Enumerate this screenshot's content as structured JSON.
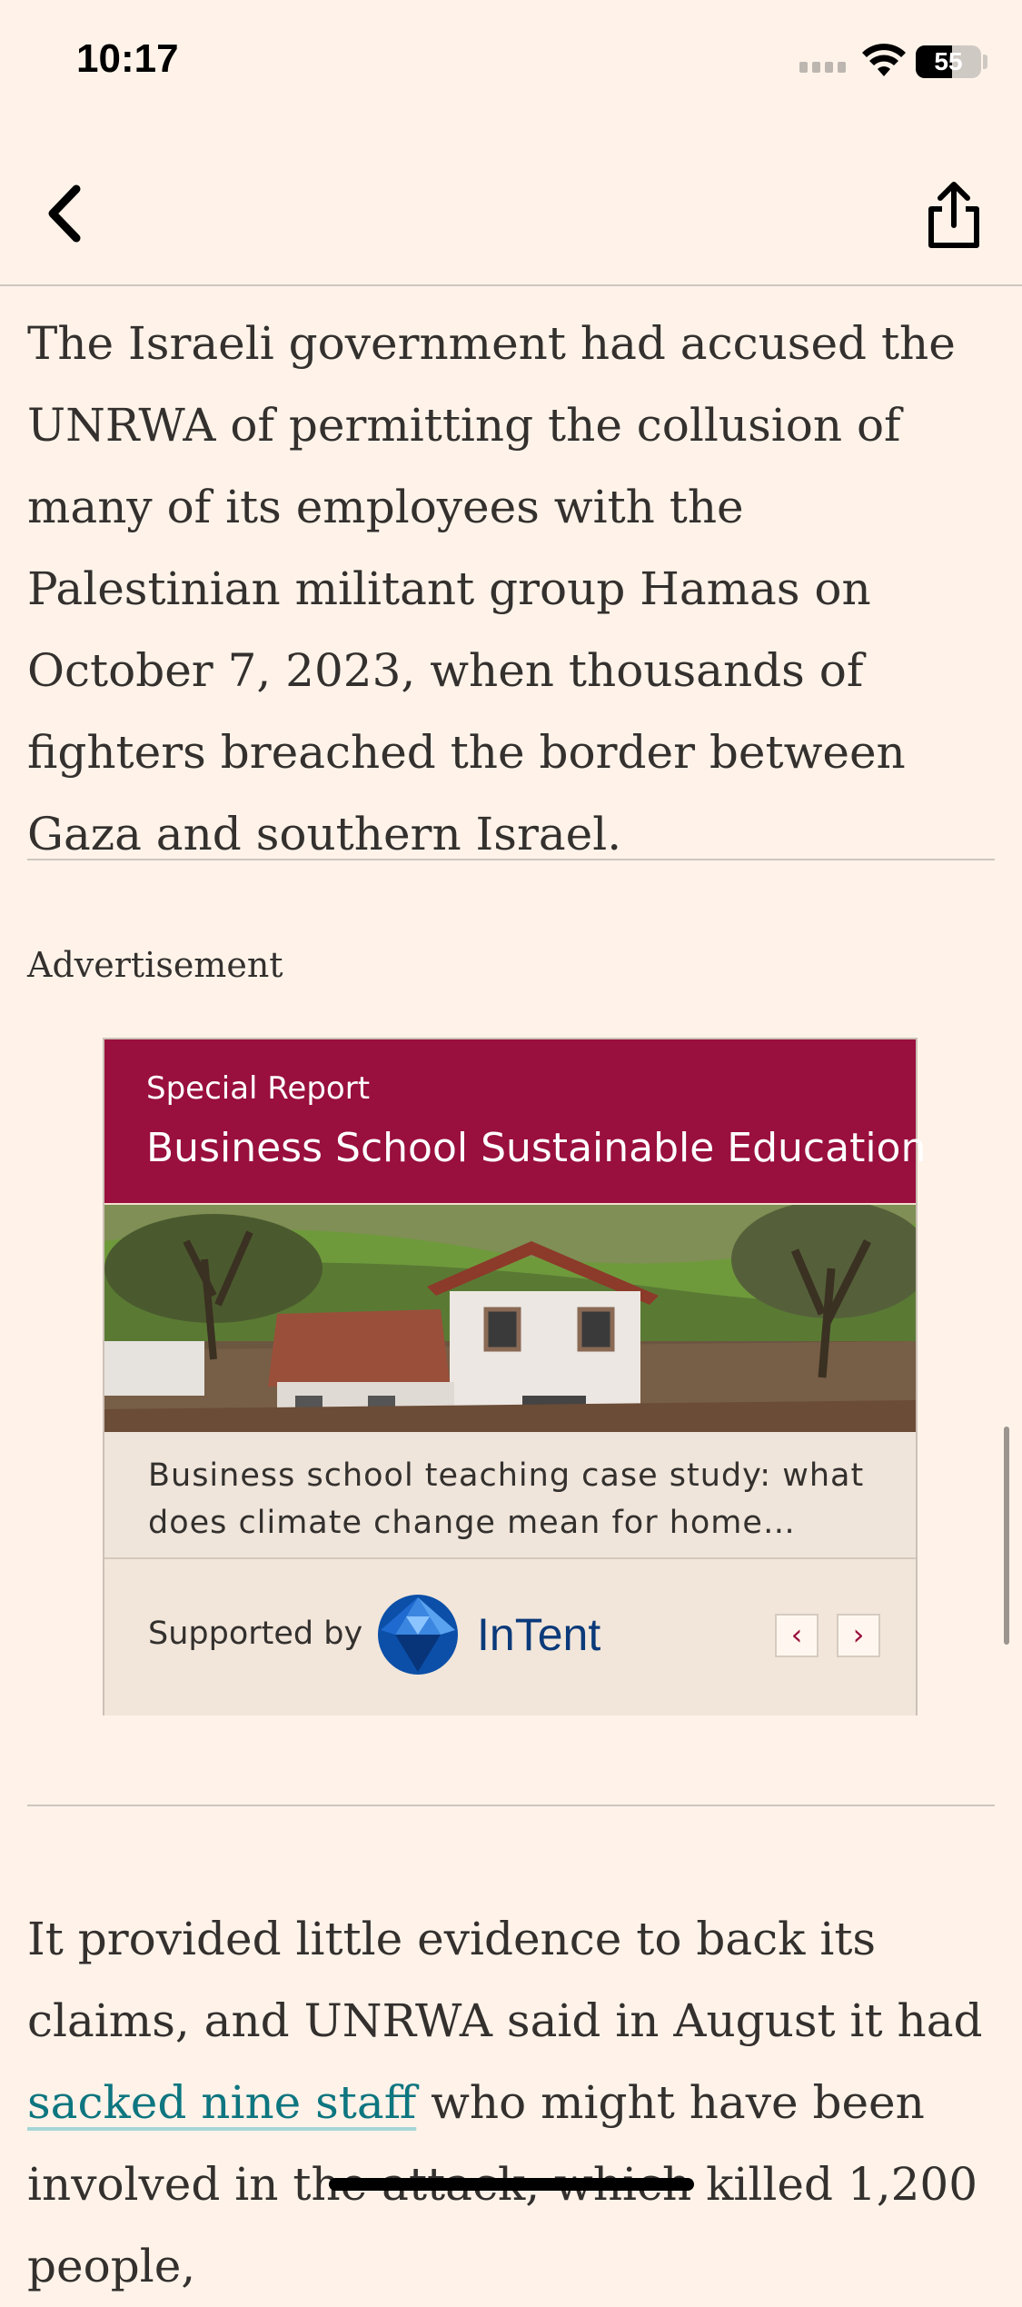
{
  "status_bar": {
    "time": "10:17",
    "battery": "55",
    "battery_level": 0.55
  },
  "nav": {
    "back_icon": "chevron-left-icon",
    "share_icon": "share-icon"
  },
  "article": {
    "paragraph_1": "The Israeli government had accused the UNRWA of permitting the collusion of many of its employees with the Palestinian militant group Hamas on October 7, 2023, when thousands of fighters breached the border between Gaza and southern Israel.",
    "paragraph_2_before": "It provided little evidence to back its claims, and UNRWA said in August it had ",
    "paragraph_2_link": "sacked nine staff",
    "paragraph_2_after": " who might have been involved in the attack, which killed 1,200 people,"
  },
  "advertisement": {
    "label": "Advertisement",
    "kicker": "Special Report",
    "title": "Business School Sustainable Education",
    "caption": "Business school teaching case study: what does climate change mean for home…",
    "supported_by": "Supported by",
    "sponsor": "InTent",
    "prev": "‹",
    "next": "›",
    "colors": {
      "header": "#990f3d",
      "sponsor": "#0b3a7a"
    }
  }
}
